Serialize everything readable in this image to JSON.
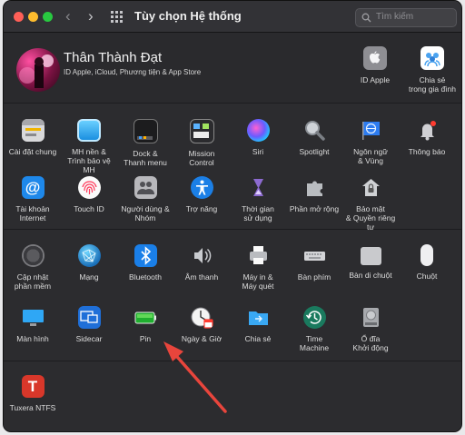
{
  "window": {
    "title": "Tùy chọn Hệ thống",
    "search_placeholder": "Tìm kiếm",
    "traffic_colors": [
      "#ff5f57",
      "#febc2e",
      "#28c840"
    ]
  },
  "user": {
    "name": "Thân Thành Đạt",
    "subtitle": "ID Apple, iCloud, Phương tiện & App Store",
    "apple_id_label": "ID Apple",
    "family_label": "Chia sẻ\ntrong gia đình"
  },
  "panes": {
    "general": "Cài đặt chung",
    "desktop": "MH nền &\nTrình bảo vệ MH",
    "dock": "Dock &\nThanh menu",
    "mission": "Mission\nControl",
    "siri": "Siri",
    "spotlight": "Spotlight",
    "language": "Ngôn ngữ\n& Vùng",
    "notifications": "Thông báo",
    "internet": "Tài khoản\nInternet",
    "touchid": "Touch ID",
    "users": "Người dùng &\nNhóm",
    "accessibility": "Trợ năng",
    "screentime": "Thời gian\nsử dụng",
    "extensions": "Phần mở rộng",
    "security": "Bảo mật\n& Quyền riêng tư",
    "update": "Cập nhật\nphần mềm",
    "network": "Mạng",
    "bluetooth": "Bluetooth",
    "sound": "Âm thanh",
    "printers": "Máy in &\nMáy quét",
    "keyboard": "Bàn phím",
    "trackpad": "Bàn di chuột",
    "mouse": "Chuột",
    "displays": "Màn hình",
    "sidecar": "Sidecar",
    "battery": "Pin",
    "datetime": "Ngày & Giờ",
    "sharing": "Chia sẻ",
    "timemachine": "Time\nMachine",
    "startup": "Ổ đĩa\nKhởi động",
    "tuxera": "Tuxera NTFS"
  },
  "annotation": {
    "arrow_color": "#e8453c"
  }
}
